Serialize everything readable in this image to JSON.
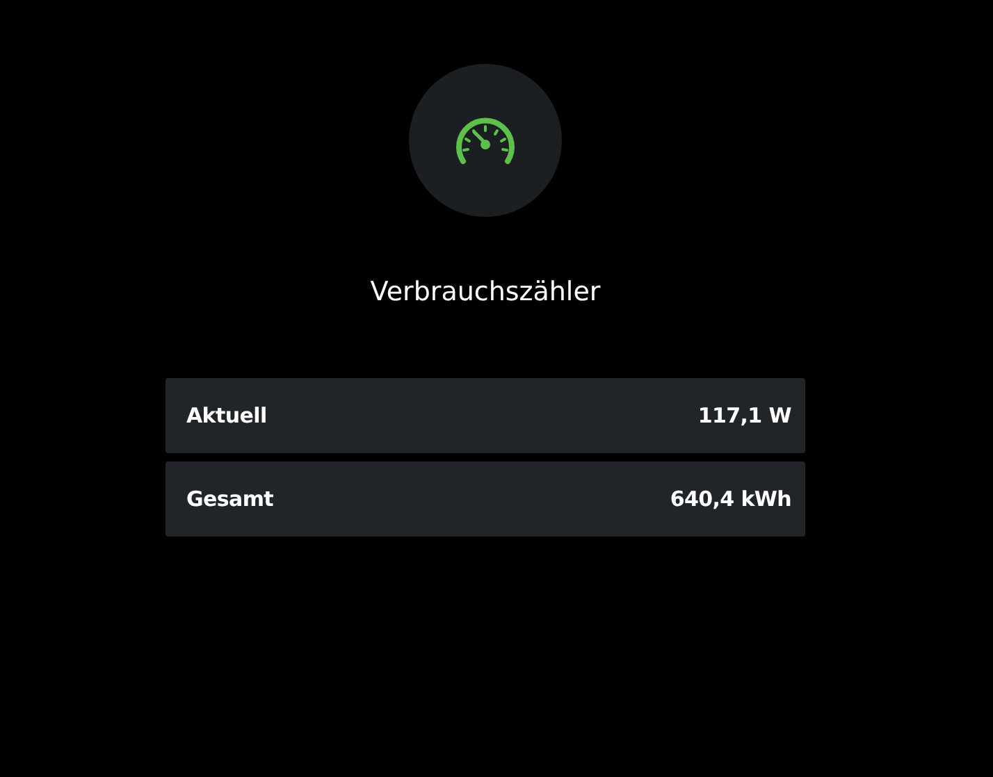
{
  "title": "Verbrauchszähler",
  "readings": [
    {
      "label": "Aktuell",
      "value": "117,1 W"
    },
    {
      "label": "Gesamt",
      "value": "640,4 kWh"
    }
  ]
}
